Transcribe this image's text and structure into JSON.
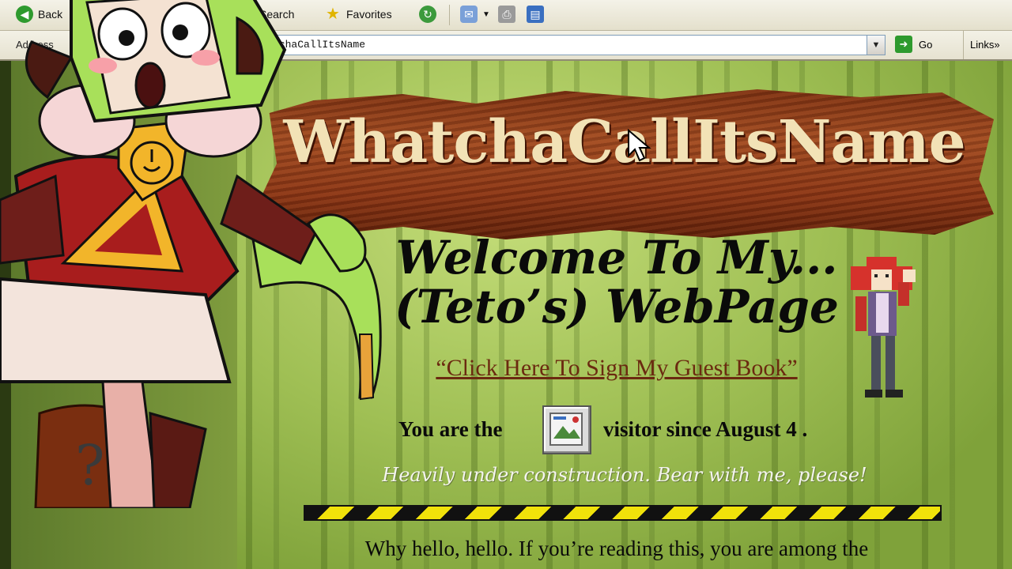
{
  "toolbar": {
    "back_label": "Back",
    "search_label": "Search",
    "favorites_label": "Favorites"
  },
  "address_bar": {
    "label": "Address",
    "url_fragment": "w/WhatchaCallItsName",
    "go_label": "Go",
    "links_label": "Links"
  },
  "page": {
    "sign_title": "WhatchaCallItsName",
    "welcome_line1": "Welcome To My...",
    "welcome_line2": "(Teto’s) WebPage",
    "guestbook_link": "“Click Here To Sign My Guest Book”",
    "visitor_prefix": "You are the",
    "visitor_suffix": "visitor since August 4 .",
    "construction_note": "Heavily under construction. Bear with me, please!",
    "intro_text": "Why hello, hello. If you’re reading this, you are among the"
  },
  "colors": {
    "sign_text": "#f2e2b6",
    "link": "#6b2a10",
    "hazard_yellow": "#f1e20a"
  }
}
